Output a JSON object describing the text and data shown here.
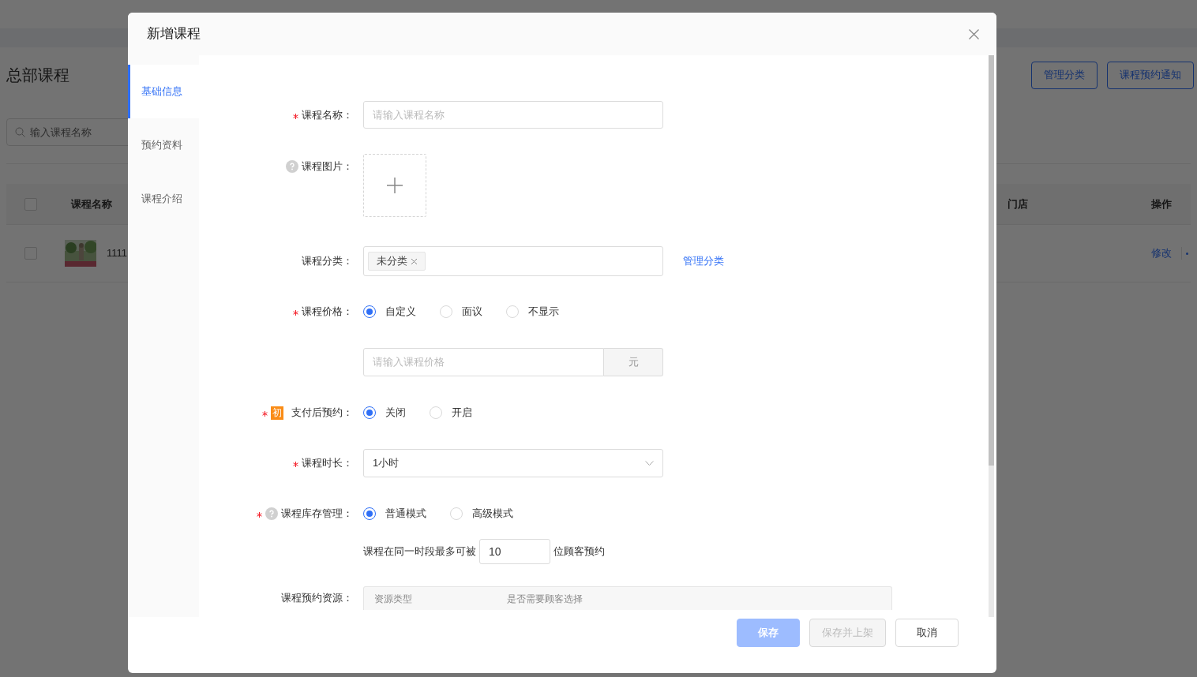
{
  "background": {
    "page_title": "总部课程",
    "buttons": [
      "管理分类",
      "课程预约通知"
    ],
    "search": {
      "placeholder": "输入课程名称"
    },
    "table": {
      "header_checked": false,
      "columns": [
        "课程名称",
        "门店",
        "操作"
      ],
      "rows": [
        {
          "checked": false,
          "name": "1111",
          "action": "修改"
        }
      ]
    }
  },
  "dialog": {
    "title": "新增课程",
    "tabs": [
      {
        "label": "基础信息",
        "selected": true
      },
      {
        "label": "预约资料",
        "selected": false
      },
      {
        "label": "课程介绍",
        "selected": false
      }
    ],
    "fields": [
      {
        "kind": "text",
        "label": "课程名称：",
        "required": true,
        "placeholder": "请输入课程名称"
      },
      {
        "kind": "upload",
        "label": "课程图片：",
        "help": true
      },
      {
        "kind": "tags",
        "label": "课程分类：",
        "tags": [
          "未分类"
        ],
        "link": "管理分类"
      },
      {
        "kind": "radio",
        "label": "课程价格：",
        "required": true,
        "options": [
          {
            "label": "自定义",
            "selected": true
          },
          {
            "label": "面议",
            "selected": false
          },
          {
            "label": "不显示",
            "selected": false
          }
        ]
      },
      {
        "kind": "addon",
        "placeholder": "请输入课程价格",
        "addon": "元"
      },
      {
        "kind": "radio",
        "label": "支付后预约：",
        "required": true,
        "badge": "初",
        "options": [
          {
            "label": "关闭",
            "selected": true
          },
          {
            "label": "开启",
            "selected": false
          }
        ]
      },
      {
        "kind": "select",
        "label": "课程时长：",
        "required": true,
        "value": "1小时"
      },
      {
        "kind": "radio",
        "label": "课程库存管理：",
        "required": true,
        "help": true,
        "options": [
          {
            "label": "普通模式",
            "selected": true
          },
          {
            "label": "高级模式",
            "selected": false
          }
        ]
      },
      {
        "kind": "capacity",
        "before": "课程在同一时段最多可被",
        "value": "10",
        "after": "位顾客预约"
      },
      {
        "kind": "resources",
        "label": "课程预约资源：",
        "columns": [
          "资源类型",
          "是否需要顾客选择"
        ]
      }
    ],
    "buttons": [
      {
        "label": "保存",
        "kind": "primary",
        "disabled": true
      },
      {
        "label": "保存并上架",
        "kind": "default",
        "disabled": true
      },
      {
        "label": "取消",
        "kind": "default",
        "disabled": false
      }
    ]
  }
}
